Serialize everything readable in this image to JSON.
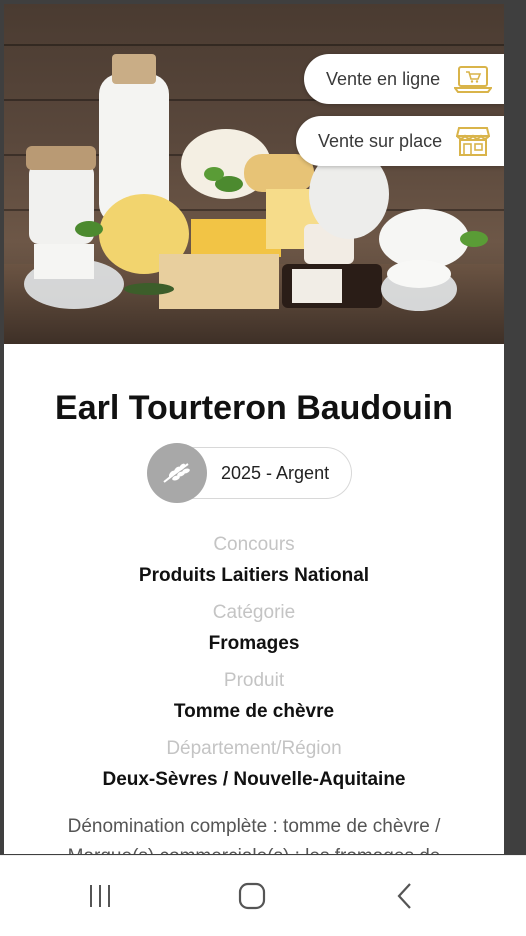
{
  "hero": {
    "online_sale_label": "Vente en ligne",
    "onsite_sale_label": "Vente sur place",
    "accent_color": "#d9b44a"
  },
  "producer": {
    "name": "Earl Tourteron Baudouin",
    "award": "2025 - Argent"
  },
  "info": [
    {
      "label": "Concours",
      "value": "Produits Laitiers National"
    },
    {
      "label": "Catégorie",
      "value": "Fromages"
    },
    {
      "label": "Produit",
      "value": "Tomme de chèvre"
    },
    {
      "label": "Département/Région",
      "value": "Deux-Sèvres / Nouvelle-Aquitaine"
    }
  ],
  "description": {
    "line1": "Dénomination complète : tomme de chèvre /",
    "line2": "Marque(s) commerciale(s) : les fromages de"
  },
  "navbar": {
    "icons": [
      "recent-apps-icon",
      "home-icon",
      "back-icon"
    ]
  }
}
